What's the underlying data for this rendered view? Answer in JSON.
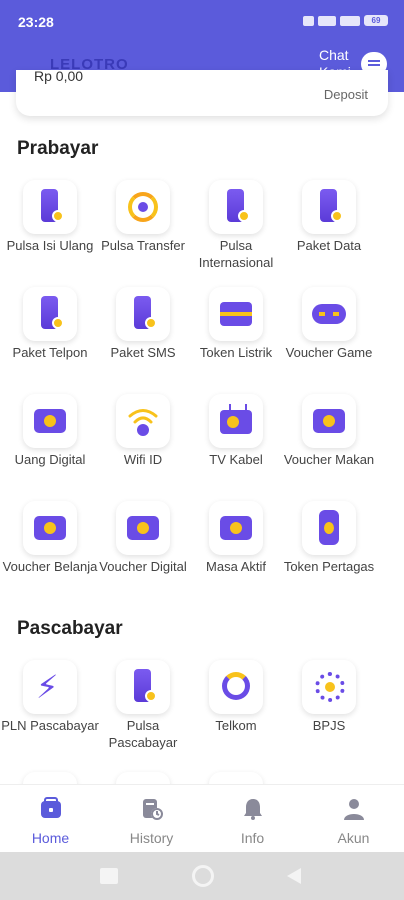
{
  "status_bar": {
    "time": "23:28",
    "battery": "69"
  },
  "header": {
    "brand": "LELOTRO",
    "chat_label": "Chat Kami"
  },
  "balance": {
    "amount": "Rp 0,00",
    "deposit_label": "Deposit"
  },
  "sections": {
    "prabayar": {
      "title": "Prabayar",
      "items": [
        {
          "label": "Pulsa Isi Ulang",
          "icon": "phone-icon"
        },
        {
          "label": "Pulsa Transfer",
          "icon": "transfer-icon"
        },
        {
          "label": "Pulsa Internasional",
          "icon": "phone-icon"
        },
        {
          "label": "Paket Data",
          "icon": "phone-icon"
        },
        {
          "label": "Paket Telpon",
          "icon": "phone-icon"
        },
        {
          "label": "Paket SMS",
          "icon": "phone-icon"
        },
        {
          "label": "Token Listrik",
          "icon": "token-card-icon"
        },
        {
          "label": "Voucher Game",
          "icon": "gamepad-icon"
        },
        {
          "label": "Uang Digital",
          "icon": "wallet-icon"
        },
        {
          "label": "Wifi ID",
          "icon": "wifi-icon"
        },
        {
          "label": "TV Kabel",
          "icon": "tv-icon"
        },
        {
          "label": "Voucher Makan",
          "icon": "wallet-icon"
        },
        {
          "label": "Voucher Belanja",
          "icon": "wallet-icon"
        },
        {
          "label": "Voucher Digital",
          "icon": "wallet-icon"
        },
        {
          "label": "Masa Aktif",
          "icon": "wallet-icon"
        },
        {
          "label": "Token Pertagas",
          "icon": "gas-icon"
        }
      ]
    },
    "pascabayar": {
      "title": "Pascabayar",
      "items": [
        {
          "label": "PLN Pascabayar",
          "icon": "bolt-icon"
        },
        {
          "label": "Pulsa Pascabayar",
          "icon": "phone-icon"
        },
        {
          "label": "Telkom",
          "icon": "telkom-icon"
        },
        {
          "label": "BPJS",
          "icon": "bpjs-icon"
        }
      ]
    }
  },
  "bottom_nav": [
    {
      "label": "Home",
      "icon": "home-icon",
      "active": true
    },
    {
      "label": "History",
      "icon": "history-icon",
      "active": false
    },
    {
      "label": "Info",
      "icon": "bell-icon",
      "active": false
    },
    {
      "label": "Akun",
      "icon": "user-icon",
      "active": false
    }
  ],
  "colors": {
    "primary": "#5b5bdb",
    "accent": "#f8c21b",
    "icon_purple": "#6a4ce6"
  }
}
